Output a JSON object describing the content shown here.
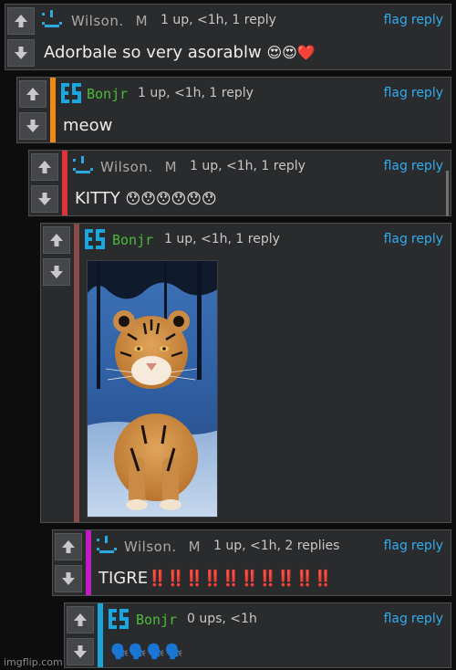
{
  "colors": {
    "panel": "#2a2b2d",
    "accent_wilson_1": "#2a2b2d",
    "accent_orange": "#f08a13",
    "accent_red": "#e0323b",
    "accent_brown": "#8a4a4a",
    "accent_magenta": "#c21bc2",
    "accent_cyan": "#1aa6d8",
    "link": "#33aaee",
    "username_bonjr": "#4cbb3a",
    "username_wilson": "#a9a9a9"
  },
  "icons": [
    "upvote-arrow-icon",
    "downvote-arrow-icon",
    "pixel-face-avatar-icon",
    "es-logo-avatar-icon"
  ],
  "comments": [
    {
      "username": "Wilson.",
      "badge": "M",
      "meta": "1 up, <1h, 1 reply",
      "flag": "flag",
      "reply": "reply",
      "text": "Adorbale so very asorablw",
      "emojis": "😍😍❤️"
    },
    {
      "username": "Bonjr",
      "meta": "1 up, <1h, 1 reply",
      "flag": "flag",
      "reply": "reply",
      "text": "meow"
    },
    {
      "username": "Wilson.",
      "badge": "M",
      "meta": "1 up, <1h, 1 reply",
      "flag": "flag",
      "reply": "reply",
      "text": "KITTY",
      "emojis": "😯😯😯😯😯😯"
    },
    {
      "username": "Bonjr",
      "meta": "1 up, <1h, 1 reply",
      "flag": "flag",
      "reply": "reply"
    },
    {
      "username": "Wilson.",
      "badge": "M",
      "meta": "1 up, <1h, 2 replies",
      "flag": "flag",
      "reply": "reply",
      "text": "TIGRE",
      "emojis": "‼️‼️‼️‼️‼️‼️‼️‼️‼️‼️"
    },
    {
      "username": "Bonjr",
      "meta": "0 ups, <1h",
      "flag": "flag",
      "reply": "reply",
      "emojis": "🗣️🗣️🗣️🗣️"
    }
  ],
  "watermark": "imgflip.com"
}
